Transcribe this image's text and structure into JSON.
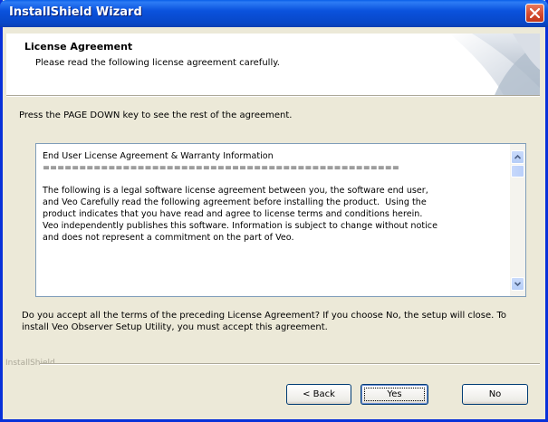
{
  "window": {
    "title": "InstallShield Wizard",
    "close_label": "×"
  },
  "header": {
    "title": "License Agreement",
    "subtitle": "Please read the following license agreement carefully."
  },
  "instruction": "Press the PAGE DOWN key to see the rest of the agreement.",
  "license": {
    "text": "End User License Agreement & Warranty Information\n=================================================\n\nThe following is a legal software license agreement between you, the software end user,\nand Veo Carefully read the following agreement before installing the product.  Using the\nproduct indicates that you have read and agree to license terms and conditions herein.\nVeo independently publishes this software. Information is subject to change without notice\nand does not represent a commitment on the part of Veo."
  },
  "question": "Do you accept all the terms of the preceding License Agreement?  If you choose No,  the setup will close.  To install Veo Observer Setup Utility, you must accept this agreement.",
  "footer": {
    "brand_label": "InstallShield"
  },
  "buttons": {
    "back": "< Back",
    "yes": "Yes",
    "no": "No"
  },
  "colors": {
    "titlebar": "#0a52dd",
    "window_bg": "#ece9d8",
    "close_button": "#d2472b"
  },
  "icons": {
    "close": "close-icon",
    "scroll_up": "chevron-up-icon",
    "scroll_down": "chevron-down-icon"
  }
}
